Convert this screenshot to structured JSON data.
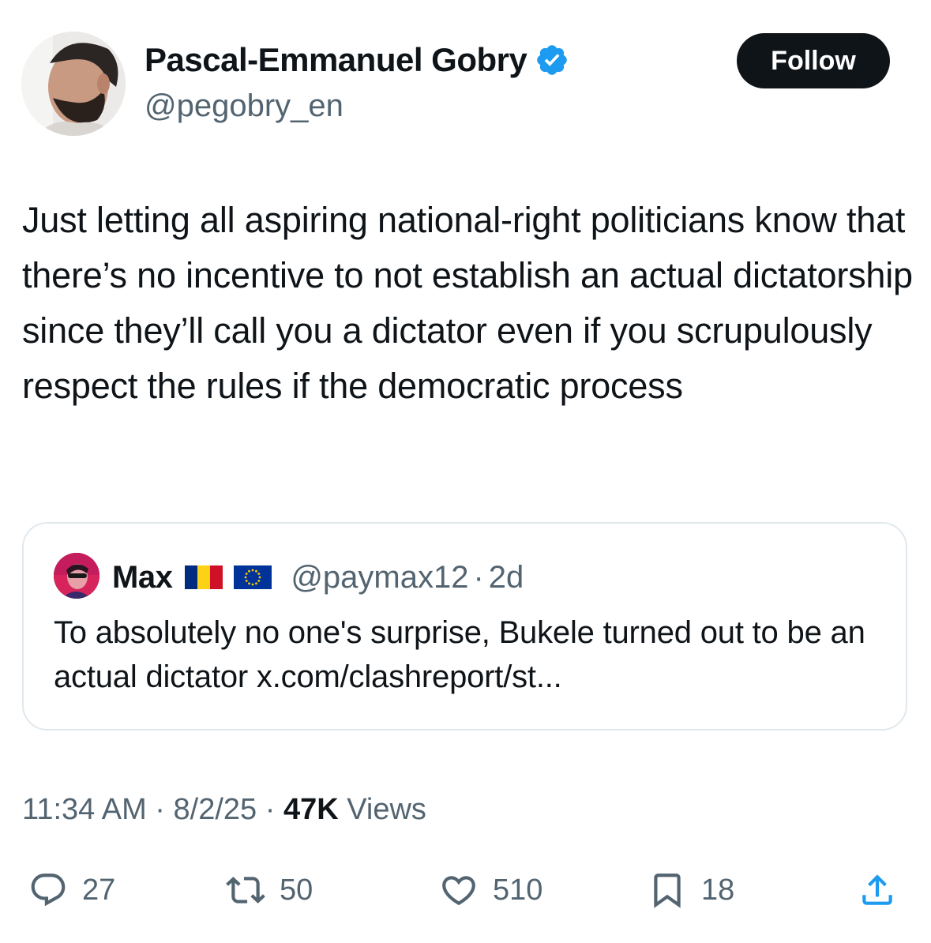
{
  "author": {
    "display_name": "Pascal-Emmanuel Gobry",
    "handle": "@pegobry_en",
    "verified_icon": "verified-badge-icon",
    "verified_color": "#1d9bf0"
  },
  "follow_label": "Follow",
  "tweet_text": "Just letting all aspiring national-right politicians know that there’s no incentive to not establish an actual dictatorship since they’ll call you a dictator even if you scrupulously respect the rules if the democratic process",
  "quote": {
    "name": "Max",
    "flags": [
      "romania-flag",
      "eu-flag"
    ],
    "handle": "@paymax12",
    "separator": "·",
    "time": "2d",
    "text": "To absolutely no one's surprise, Bukele turned out to be an actual dictator x.com/clashreport/st..."
  },
  "meta": {
    "time": "11:34 AM",
    "sep1": " · ",
    "date": "8/2/25",
    "sep2": " · ",
    "views_count": "47K",
    "views_label": " Views"
  },
  "actions": {
    "replies": "27",
    "reposts": "50",
    "likes": "510",
    "bookmarks": "18"
  },
  "colors": {
    "text": "#0f1419",
    "secondary": "#536471",
    "border": "#e1e8ed",
    "button_bg": "#0f1419"
  }
}
